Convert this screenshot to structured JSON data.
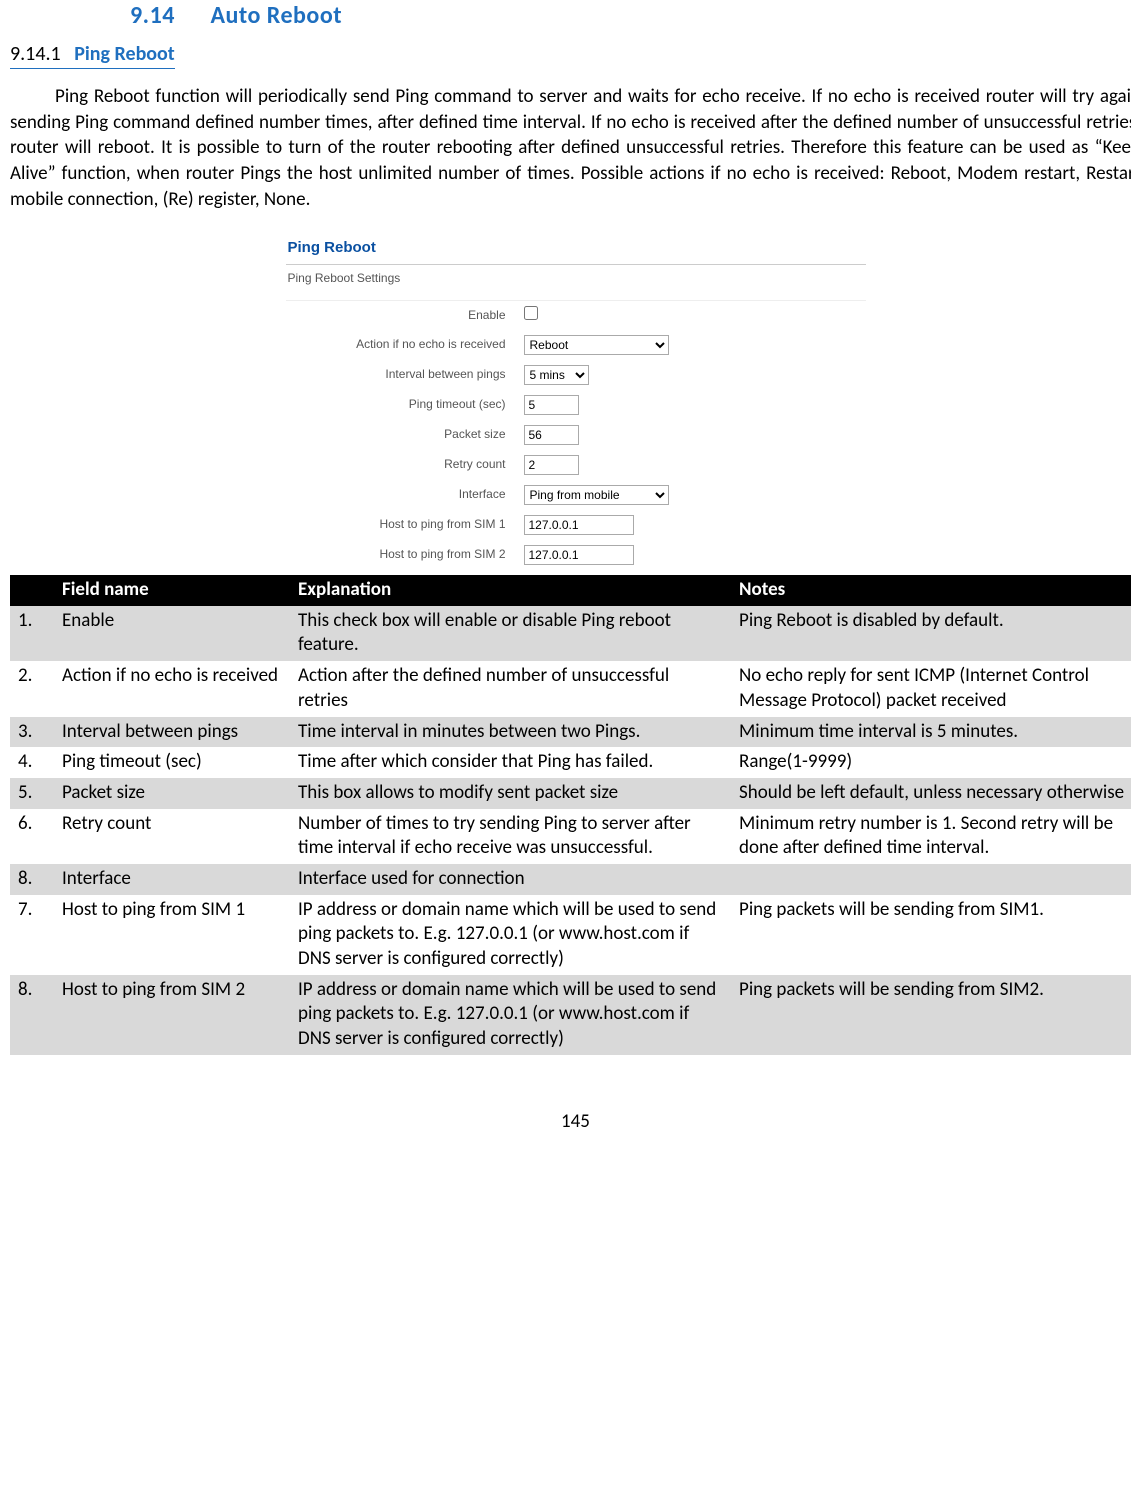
{
  "heading": {
    "num": "9.14",
    "title": "Auto Reboot"
  },
  "subheading": {
    "num": "9.14.1",
    "title": "Ping Reboot"
  },
  "paragraph": "Ping Reboot function will periodically send Ping command to server and waits for echo receive. If no echo is received router will try again sending Ping command defined number times, after defined time interval. If no echo is received after the defined number of unsuccessful retries, router will reboot. It is possible to turn of the router rebooting after defined unsuccessful retries. Therefore this feature can be used as “Keep Alive” function, when router Pings the host unlimited number of times. Possible actions if no echo is received: Reboot, Modem restart, Restart mobile connection, (Re) register, None.",
  "form": {
    "title": "Ping Reboot",
    "section": "Ping Reboot Settings",
    "labels": {
      "enable": "Enable",
      "action": "Action if no echo is received",
      "interval": "Interval between pings",
      "timeout": "Ping timeout (sec)",
      "packet": "Packet size",
      "retry": "Retry count",
      "iface": "Interface",
      "host1": "Host to ping from SIM 1",
      "host2": "Host to ping from SIM 2"
    },
    "values": {
      "action": "Reboot",
      "interval": "5 mins",
      "timeout": "5",
      "packet": "56",
      "retry": "2",
      "iface": "Ping from mobile",
      "host1": "127.0.0.1",
      "host2": "127.0.0.1"
    }
  },
  "table": {
    "headers": {
      "c1": "",
      "c2": "Field name",
      "c3": "Explanation",
      "c4": "Notes"
    },
    "rows": [
      {
        "n": "1.",
        "f": "Enable",
        "e": "This check box will enable or disable Ping reboot feature.",
        "o": "Ping Reboot is disabled by default."
      },
      {
        "n": "2.",
        "f": "Action if no echo is received",
        "e": "Action after the defined number of unsuccessful retries",
        "o": "No echo reply for sent ICMP (Internet Control Message Protocol) packet received"
      },
      {
        "n": "3.",
        "f": "Interval between pings",
        "e": "Time interval in minutes between two Pings.",
        "o": "Minimum time interval is 5 minutes."
      },
      {
        "n": "4.",
        "f": "Ping timeout (sec)",
        "e": "Time after which consider that Ping has failed.",
        "o": "Range(1-9999)"
      },
      {
        "n": "5.",
        "f": "Packet size",
        "e": "This box allows to modify sent packet size",
        "o": "Should be left default, unless necessary otherwise"
      },
      {
        "n": "6.",
        "f": "Retry count",
        "e": "Number of times to try sending Ping to server after time interval if echo receive was unsuccessful.",
        "o": "Minimum retry number is 1. Second retry will be done after defined time interval."
      },
      {
        "n": "8.",
        "f": "Interface",
        "e": "Interface used for connection",
        "o": ""
      },
      {
        "n": "7.",
        "f": "Host to ping from SIM 1",
        "e": "IP address or domain name which will be used to send ping packets to. E.g. 127.0.0.1 (or www.host.com if DNS server is configured correctly)",
        "o": "Ping packets will be sending from SIM1."
      },
      {
        "n": "8.",
        "f": "Host to ping from SIM 2",
        "e": "IP address or domain name which will be used to send ping packets to. E.g. 127.0.0.1 (or www.host.com if DNS server is configured correctly)",
        "o": "Ping packets will be sending from SIM2."
      }
    ]
  },
  "pageNumber": "145"
}
